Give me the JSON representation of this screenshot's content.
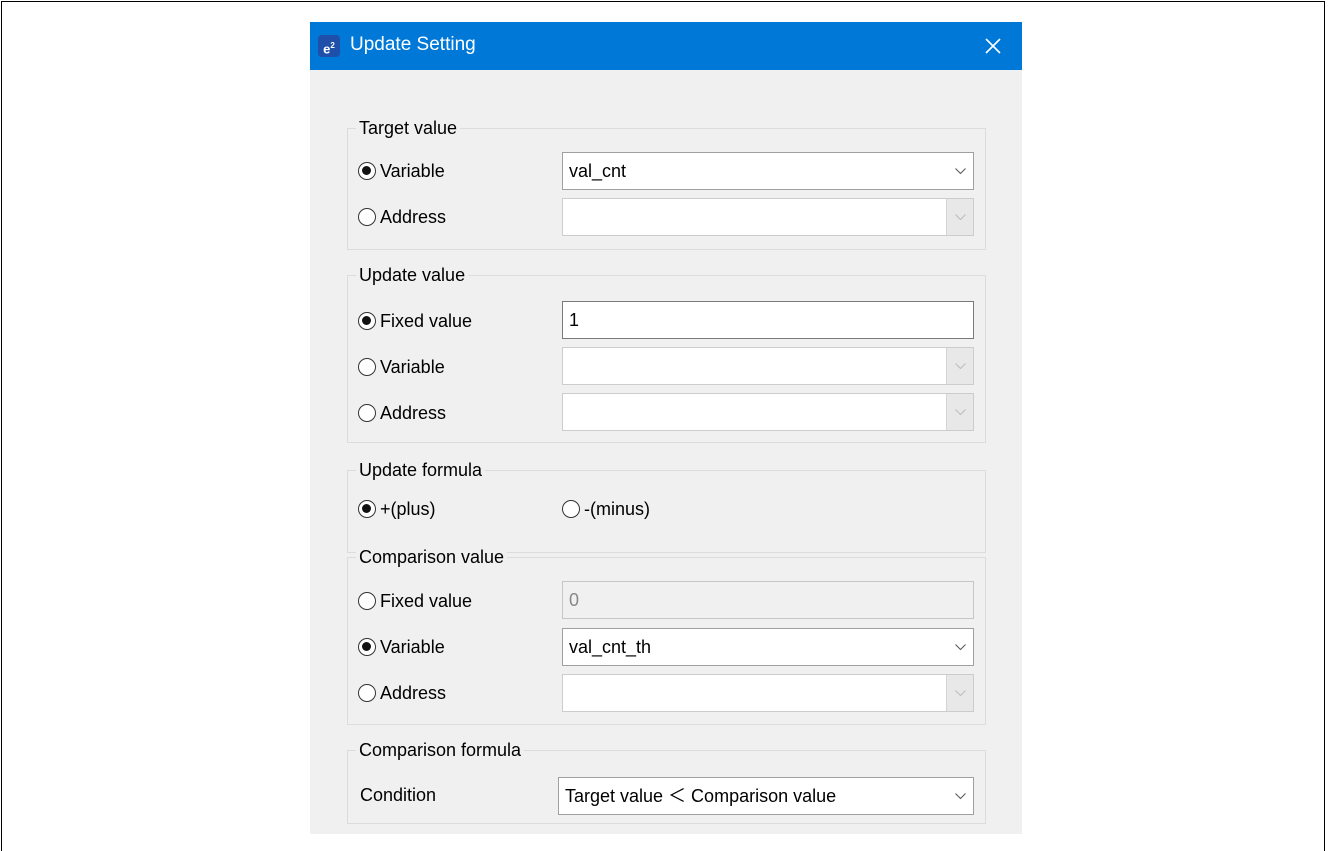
{
  "dialog": {
    "title": "Update Setting",
    "app_icon_text": "e",
    "app_icon_sup": "2"
  },
  "target_value": {
    "legend": "Target value",
    "variable_label": "Variable",
    "variable_selected": true,
    "variable_value": "val_cnt",
    "address_label": "Address",
    "address_selected": false,
    "address_value": ""
  },
  "update_value": {
    "legend": "Update value",
    "fixed_label": "Fixed value",
    "fixed_selected": true,
    "fixed_value": "1",
    "variable_label": "Variable",
    "variable_selected": false,
    "variable_value": "",
    "address_label": "Address",
    "address_selected": false,
    "address_value": ""
  },
  "update_formula": {
    "legend": "Update formula",
    "plus_label": "+(plus)",
    "plus_selected": true,
    "minus_label": "-(minus)",
    "minus_selected": false
  },
  "comparison_value": {
    "legend": "Comparison value",
    "fixed_label": "Fixed value",
    "fixed_selected": false,
    "fixed_value": "0",
    "variable_label": "Variable",
    "variable_selected": true,
    "variable_value": "val_cnt_th",
    "address_label": "Address",
    "address_selected": false,
    "address_value": ""
  },
  "comparison_formula": {
    "legend": "Comparison formula",
    "condition_label": "Condition",
    "condition_value": "Target value ＜ Comparison value"
  },
  "colors": {
    "titlebar": "#0078d7",
    "dialog_bg": "#f0f0f0"
  },
  "icons": {
    "close": "close-icon",
    "app": "app-icon",
    "dropdown": "chevron-down-icon"
  }
}
